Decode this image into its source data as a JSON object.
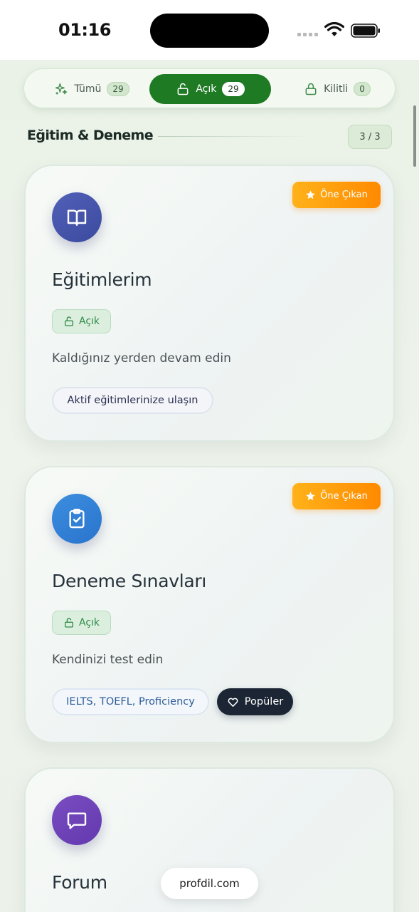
{
  "status_bar": {
    "time": "01:16"
  },
  "filter_tabs": [
    {
      "label": "Tümü",
      "count": "29",
      "icon": "sparkles-icon",
      "active": false
    },
    {
      "label": "Açık",
      "count": "29",
      "icon": "unlock-icon",
      "active": true
    },
    {
      "label": "Kilitli",
      "count": "0",
      "icon": "lock-icon",
      "active": false
    }
  ],
  "section": {
    "title": "Eğitim & Deneme",
    "counter": "3 / 3"
  },
  "cards": [
    {
      "title": "Eğitimlerim",
      "icon": "book-open-icon",
      "icon_color": "#4452a8",
      "featured_label": "Öne Çıkan",
      "status_label": "Açık",
      "description": "Kaldığınız yerden devam edin",
      "chips": [
        "Aktif eğitimlerinize ulaşın"
      ]
    },
    {
      "title": "Deneme Sınavları",
      "icon": "clipboard-check-icon",
      "icon_color": "#2f7fd6",
      "featured_label": "Öne Çıkan",
      "status_label": "Açık",
      "description": "Kendinizi test edin",
      "chips": [
        "IELTS, TOEFL, Proficiency"
      ],
      "popular_label": "Popüler"
    },
    {
      "title": "Forum",
      "icon": "message-square-icon",
      "icon_color": "#6f45b8"
    }
  ],
  "colors": {
    "accent_green": "#1f7a24",
    "featured_orange": "#ff9a00",
    "open_green": "#2f8a48"
  },
  "domain_pill": "profdil.com"
}
